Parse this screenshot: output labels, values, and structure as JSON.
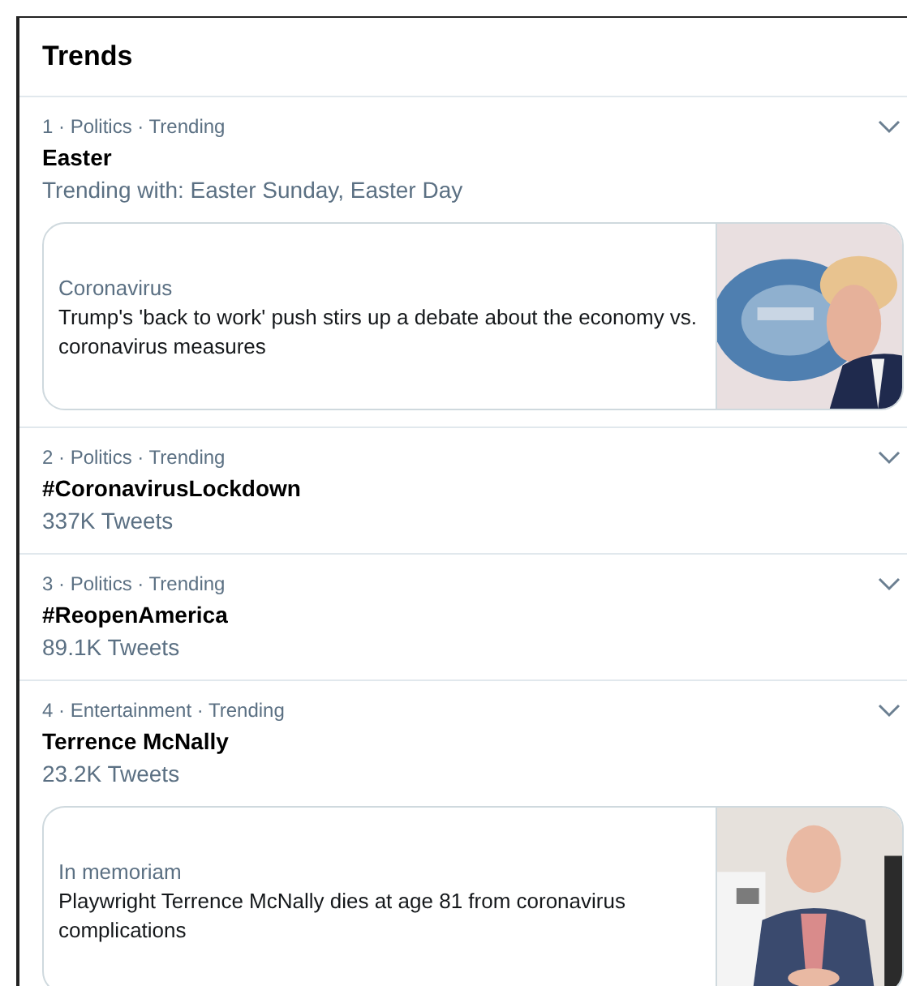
{
  "title": "Trends",
  "trends": [
    {
      "meta": "1 · Politics · Trending",
      "name": "Easter",
      "detail": "Trending with: Easter Sunday, Easter Day",
      "card": {
        "topic": "Coronavirus",
        "headline": "Trump's 'back to work' push stirs up a debate about the economy vs. coronavirus measures"
      }
    },
    {
      "meta": "2 · Politics · Trending",
      "name": "#CoronavirusLockdown",
      "detail": "337K Tweets"
    },
    {
      "meta": "3 · Politics · Trending",
      "name": "#ReopenAmerica",
      "detail": "89.1K Tweets"
    },
    {
      "meta": "4 · Entertainment · Trending",
      "name": "Terrence McNally",
      "detail": "23.2K Tweets",
      "card": {
        "topic": "In memoriam",
        "headline": "Playwright Terrence McNally dies at age 81 from coronavirus complications"
      }
    }
  ]
}
